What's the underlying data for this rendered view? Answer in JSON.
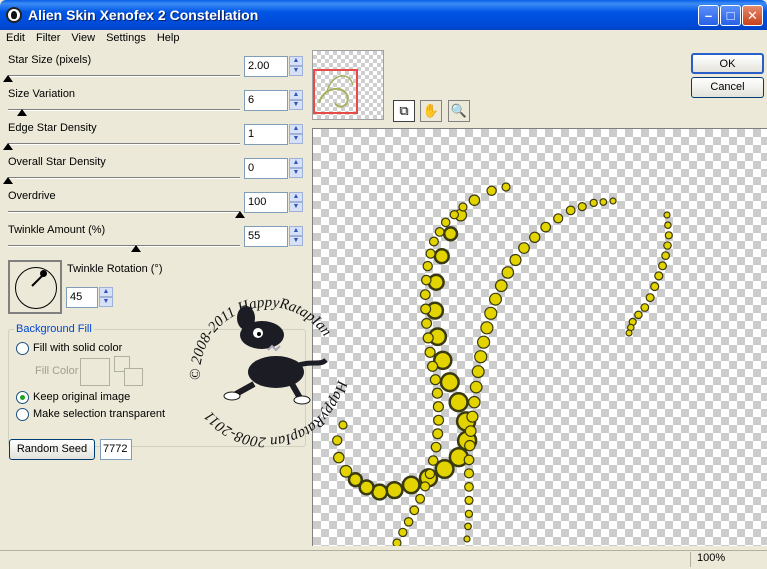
{
  "window": {
    "title": "Alien Skin Xenofex 2 Constellation"
  },
  "menu": [
    "Edit",
    "Filter",
    "View",
    "Settings",
    "Help"
  ],
  "params": [
    {
      "label": "Star Size (pixels)",
      "value": "2.00",
      "level": 0.0
    },
    {
      "label": "Size Variation",
      "value": "6",
      "level": 0.06
    },
    {
      "label": "Edge Star Density",
      "value": "1",
      "level": 0.0
    },
    {
      "label": "Overall Star Density",
      "value": "0",
      "level": 0.0
    },
    {
      "label": "Overdrive",
      "value": "100",
      "level": 1.0
    },
    {
      "label": "Twinkle Amount (%)",
      "value": "55",
      "level": 0.55
    }
  ],
  "twinkle_rotation": {
    "label": "Twinkle Rotation (°)",
    "value": "45"
  },
  "background_fill": {
    "title": "Background Fill",
    "option_solid": "Fill with solid color",
    "fill_color_label": "Fill Color",
    "option_keep": "Keep original image",
    "option_transparent": "Make selection transparent",
    "selected": "keep"
  },
  "random_seed": {
    "button": "Random Seed",
    "value": "7772"
  },
  "buttons": {
    "ok": "OK",
    "cancel": "Cancel"
  },
  "watermark": {
    "line1": "© 2008-2011  HappyRatapIan",
    "line2": "HappyRatapIan 2008-2011"
  },
  "status": {
    "zoom": "100%"
  },
  "colors": {
    "star": "#e3d400",
    "star_outline": "#3a3a10",
    "titlebar": "#0055e5",
    "thumb_frame": "#e84a4a"
  }
}
